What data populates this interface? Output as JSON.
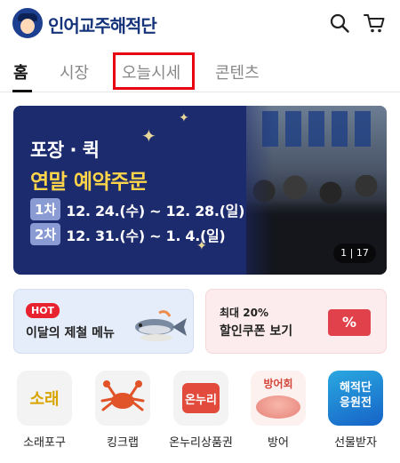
{
  "header": {
    "brand": "인어교주해적단",
    "search_icon": "search-icon",
    "cart_icon": "cart-icon"
  },
  "tabs": [
    {
      "label": "홈",
      "active": true
    },
    {
      "label": "시장",
      "active": false
    },
    {
      "label": "오늘시세",
      "active": false
    },
    {
      "label": "콘텐츠",
      "active": false
    }
  ],
  "banner": {
    "title_line1": "포장 · 퀵",
    "title_line2": "연말 예약주문",
    "rows": [
      {
        "chip": "1차",
        "dates": "12. 24.(수) ~ 12. 28.(일)"
      },
      {
        "chip": "2차",
        "dates": "12. 31.(수) ~ 1. 4.(일)"
      }
    ],
    "pager": "1 | 17"
  },
  "promo_cards": [
    {
      "badge": "HOT",
      "label": "이달의 제철 메뉴"
    },
    {
      "sub": "최대 20%",
      "label": "할인쿠폰 보기",
      "icon_text": "%"
    }
  ],
  "categories": [
    {
      "name": "소래포구",
      "tile_text": "소래"
    },
    {
      "name": "킹크랩",
      "tile_text": ""
    },
    {
      "name": "온누리상품권",
      "tile_text": "온누리"
    },
    {
      "name": "방어",
      "tile_text": "방어회"
    },
    {
      "name": "선물받자",
      "tile_text": "해적단\n응원전"
    }
  ],
  "colors": {
    "brand": "#15337a",
    "highlight": "#e60012",
    "banner_bg": "#1c2a6e",
    "banner_accent": "#ffd54a",
    "hot": "#e8222e"
  }
}
